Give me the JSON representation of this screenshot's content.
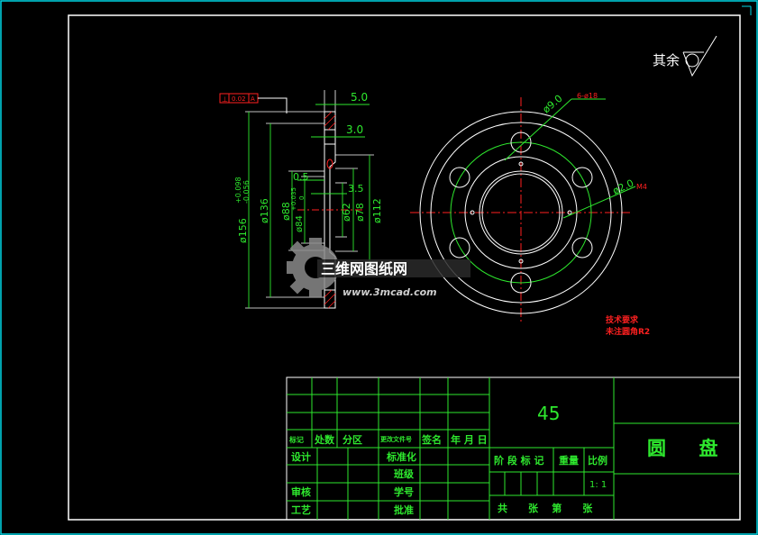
{
  "colors": {
    "background": "#000000",
    "frame": "#ffffff",
    "outer_border": "#00d7e6",
    "lines": "#2ee82e",
    "dims": "#2ee82e",
    "red": "#ff2020"
  },
  "roughness": {
    "label": "其余"
  },
  "tolerance_frame": {
    "symbol": "⊥",
    "value": "0.02",
    "datum": "A"
  },
  "side_view": {
    "dims": {
      "d_5": "5.0",
      "d_3": "3.0",
      "d_05": "0.5",
      "d_35": "3.5",
      "dia_156": "ø156",
      "tol_156_upper": "+0.098",
      "tol_156_lower": "-0.056",
      "dia_136": "ø136",
      "dia_88": "ø88",
      "dia_84": "ø84",
      "tol_84_upper": "+0.035",
      "tol_84_lower": "0",
      "dia_62": "ø62",
      "dia_78": "ø78",
      "dia_112": "ø112"
    }
  },
  "front_view": {
    "hole_dim": "ø9.0",
    "hole_note": "6-ø18",
    "small_dim": "ø2.0",
    "thread": "M4"
  },
  "watermark": {
    "brand": "三维网图纸网",
    "url": "www.3mcad.com"
  },
  "tech_req": {
    "title": "技术要求",
    "line1": "未注圆角R2"
  },
  "title_block": {
    "material": "45",
    "part_name": "圆     盘",
    "row_labels": {
      "mark": "标记",
      "count": "处数",
      "zone": "分区",
      "change_doc": "更改文件号",
      "sign": "签名",
      "date": "年 月 日"
    },
    "design": "设计",
    "standard": "标准化",
    "class": "班级",
    "review": "审核",
    "student_id": "学号",
    "process": "工艺",
    "approve": "批准",
    "stage_mark": "阶 段 标 记",
    "weight": "重量",
    "scale_label": "比例",
    "scale": "1: 1",
    "sheets": "共      张    第      张"
  }
}
